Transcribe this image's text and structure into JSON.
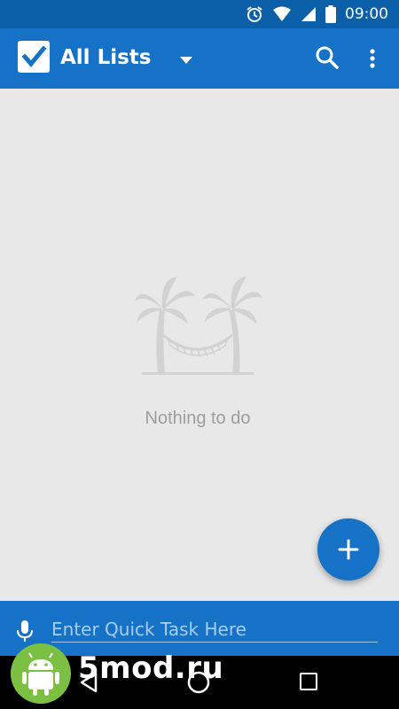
{
  "status_bar": {
    "time": "09:00",
    "icons": [
      "alarm-icon",
      "wifi-icon",
      "signal-icon",
      "battery-icon"
    ]
  },
  "app_bar": {
    "title": "All Lists",
    "icons": [
      "app-logo-check-icon",
      "dropdown-arrow-icon",
      "search-icon",
      "overflow-menu-icon"
    ]
  },
  "empty_state": {
    "illustration": "palm-trees-hammock-icon",
    "message": "Nothing to do"
  },
  "fab": {
    "icon": "plus-icon"
  },
  "quick_task": {
    "icon": "microphone-icon",
    "placeholder": "Enter Quick Task Here"
  },
  "nav_bar": {
    "icons": [
      "back-icon",
      "home-icon",
      "recent-apps-icon"
    ]
  },
  "watermark": {
    "text": "5mod.ru",
    "icon": "android-robot-icon"
  },
  "colors": {
    "primary": "#1572c6",
    "primary_dark": "#0a5fa8",
    "background": "#e8e8e8",
    "empty_text": "#9d9d9d",
    "watermark_green": "#7cc043"
  }
}
